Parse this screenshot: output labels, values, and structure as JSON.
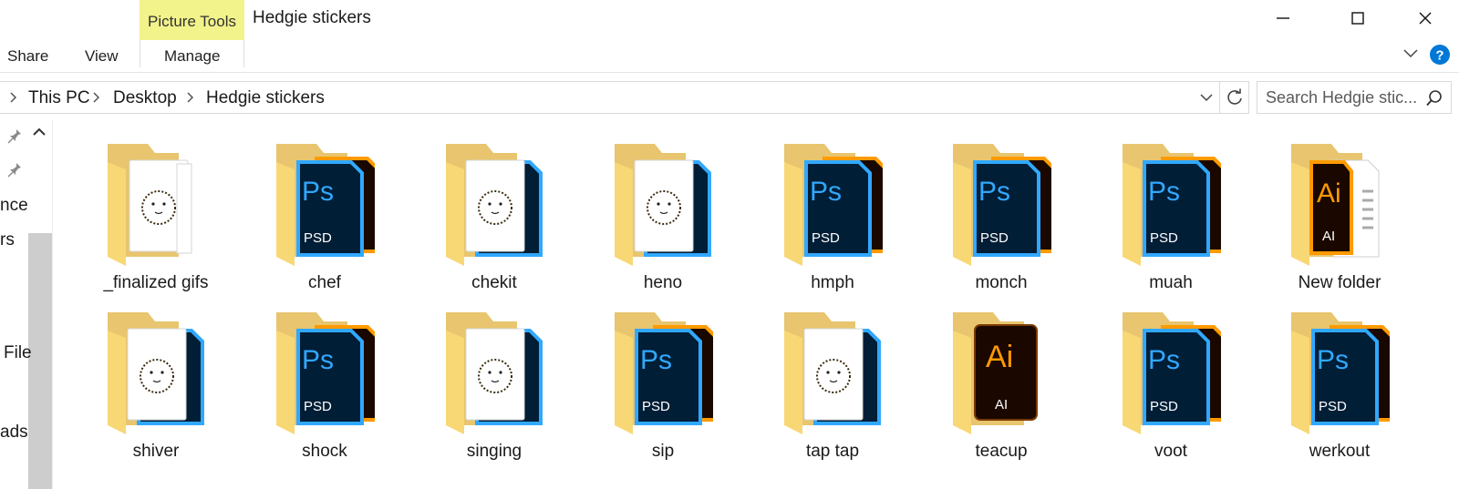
{
  "window": {
    "title": "Hedgie stickers",
    "context_tab": "Picture Tools"
  },
  "ribbon": {
    "tabs": [
      "Share",
      "View",
      "Manage"
    ]
  },
  "address_bar": {
    "breadcrumbs": [
      "This PC",
      "Desktop",
      "Hedgie stickers"
    ]
  },
  "search": {
    "placeholder": "Search Hedgie stic..."
  },
  "nav_pane": {
    "labels": [
      "nce",
      "rs",
      "File",
      "ads"
    ]
  },
  "folders": [
    {
      "name": "_finalized gifs",
      "content": "hedgie"
    },
    {
      "name": "chef",
      "content": "psd"
    },
    {
      "name": "chekit",
      "content": "hedgie-psd"
    },
    {
      "name": "heno",
      "content": "hedgie-psd"
    },
    {
      "name": "hmph",
      "content": "psd"
    },
    {
      "name": "monch",
      "content": "psd"
    },
    {
      "name": "muah",
      "content": "psd"
    },
    {
      "name": "New folder",
      "content": "ai-doc"
    },
    {
      "name": "shiver",
      "content": "hedgie-psd"
    },
    {
      "name": "shock",
      "content": "psd"
    },
    {
      "name": "singing",
      "content": "hedgie-psd"
    },
    {
      "name": "sip",
      "content": "psd"
    },
    {
      "name": "tap tap",
      "content": "hedgie-psd"
    },
    {
      "name": "teacup",
      "content": "ai"
    },
    {
      "name": "voot",
      "content": "psd"
    },
    {
      "name": "werkout",
      "content": "psd"
    }
  ],
  "colors": {
    "context_tab_bg": "#f2f38a",
    "folder_back": "#e8c56e",
    "folder_front": "#f8d775",
    "ps_dark": "#001e36",
    "ps_blue": "#31a8ff",
    "ai_dark": "#330000",
    "ai_orange": "#ff9a00",
    "help_blue": "#0078d7"
  }
}
